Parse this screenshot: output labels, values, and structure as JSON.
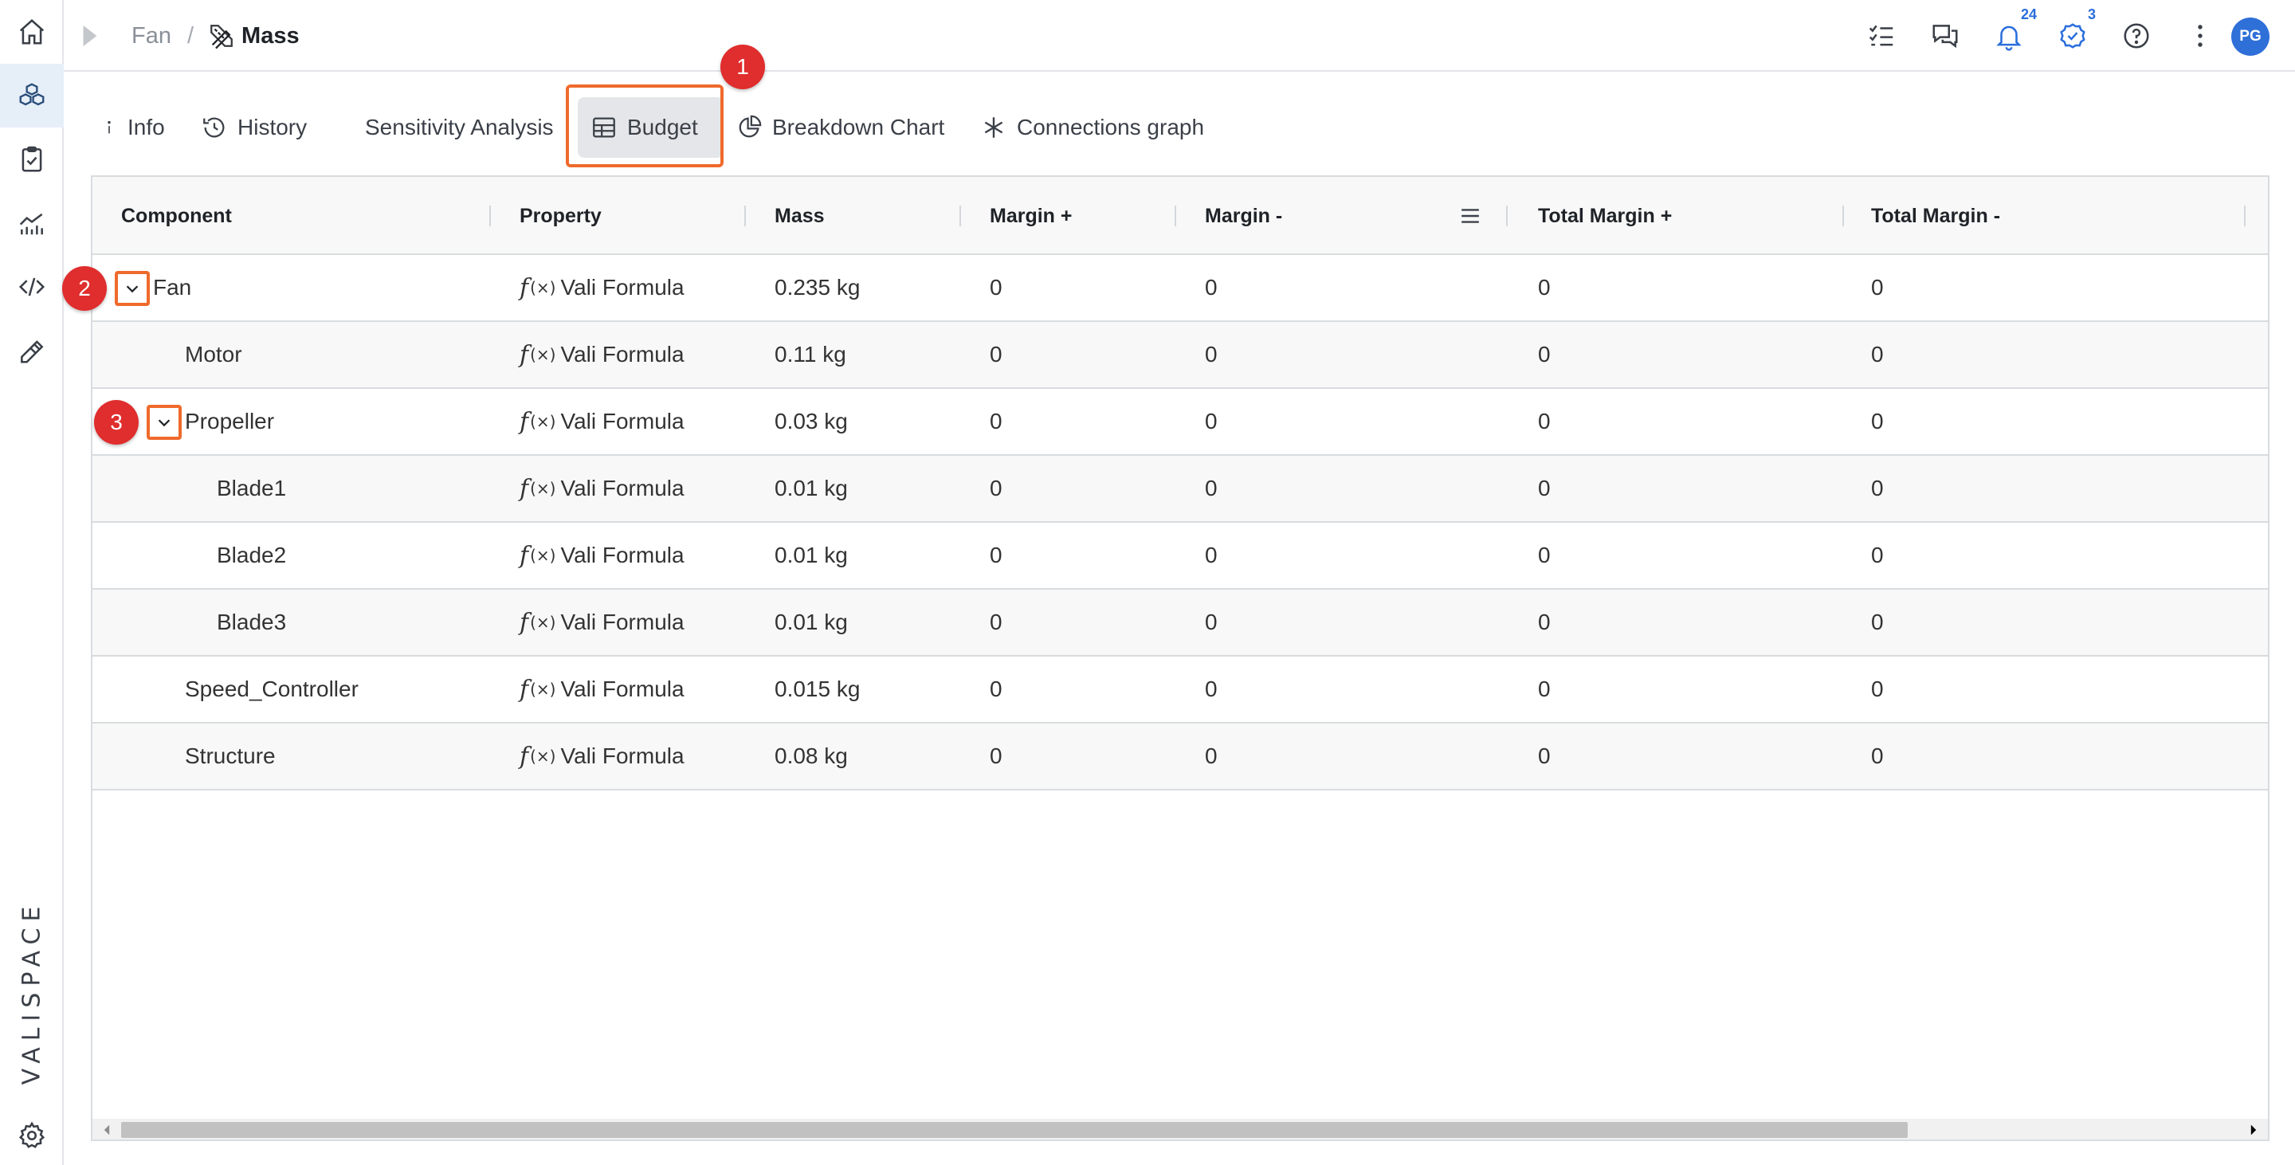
{
  "breadcrumb": {
    "parent": "Fan",
    "separator": "/",
    "current": "Mass"
  },
  "notifications": {
    "count": "24"
  },
  "tasks": {
    "count": "3"
  },
  "user": {
    "initials": "PG"
  },
  "brand": "VALISPACE",
  "tabs": [
    {
      "label": "Info",
      "icon": "info-icon"
    },
    {
      "label": "History",
      "icon": "history-icon"
    },
    {
      "label": "Sensitivity Analysis",
      "icon": ""
    },
    {
      "label": "Budget",
      "icon": "table-icon",
      "active": true
    },
    {
      "label": "Breakdown Chart",
      "icon": "pie-chart-icon"
    },
    {
      "label": "Connections graph",
      "icon": "asterisk-icon"
    }
  ],
  "markers": [
    "1",
    "2",
    "3"
  ],
  "table": {
    "columns": [
      "Component",
      "Property",
      "Mass",
      "Margin +",
      "Margin -",
      "Total Margin +",
      "Total Margin -"
    ],
    "rows": [
      {
        "component": "Fan",
        "fx": "f",
        "fx_args": "(×)",
        "property": "Vali Formula",
        "mass": "0.235 kg",
        "margin_plus": "0",
        "margin_minus": "0",
        "total_plus": "0",
        "total_minus": "0"
      },
      {
        "component": "Motor",
        "fx": "f",
        "fx_args": "(×)",
        "property": "Vali Formula",
        "mass": "0.11 kg",
        "margin_plus": "0",
        "margin_minus": "0",
        "total_plus": "0",
        "total_minus": "0"
      },
      {
        "component": "Propeller",
        "fx": "f",
        "fx_args": "(×)",
        "property": "Vali Formula",
        "mass": "0.03 kg",
        "margin_plus": "0",
        "margin_minus": "0",
        "total_plus": "0",
        "total_minus": "0"
      },
      {
        "component": "Blade1",
        "fx": "f",
        "fx_args": "(×)",
        "property": "Vali Formula",
        "mass": "0.01 kg",
        "margin_plus": "0",
        "margin_minus": "0",
        "total_plus": "0",
        "total_minus": "0"
      },
      {
        "component": "Blade2",
        "fx": "f",
        "fx_args": "(×)",
        "property": "Vali Formula",
        "mass": "0.01 kg",
        "margin_plus": "0",
        "margin_minus": "0",
        "total_plus": "0",
        "total_minus": "0"
      },
      {
        "component": "Blade3",
        "fx": "f",
        "fx_args": "(×)",
        "property": "Vali Formula",
        "mass": "0.01 kg",
        "margin_plus": "0",
        "margin_minus": "0",
        "total_plus": "0",
        "total_minus": "0"
      },
      {
        "component": "Speed_Controller",
        "fx": "f",
        "fx_args": "(×)",
        "property": "Vali Formula",
        "mass": "0.015 kg",
        "margin_plus": "0",
        "margin_minus": "0",
        "total_plus": "0",
        "total_minus": "0"
      },
      {
        "component": "Structure",
        "fx": "f",
        "fx_args": "(×)",
        "property": "Vali Formula",
        "mass": "0.08 kg",
        "margin_plus": "0",
        "margin_minus": "0",
        "total_plus": "0",
        "total_minus": "0"
      }
    ]
  },
  "colors": {
    "accent": "#2f6fd8",
    "highlight": "#ef6a2c",
    "marker": "#e02d2d"
  }
}
